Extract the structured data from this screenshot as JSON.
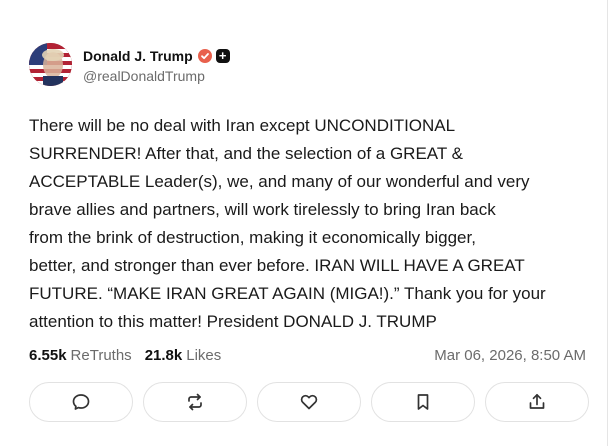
{
  "author": {
    "display_name": "Donald J. Trump",
    "handle": "@realDonaldTrump",
    "verified_icon": "verified-badge-icon",
    "plus_icon": "plus-badge-icon",
    "plus_symbol": "+",
    "accent_color": "#e8604c"
  },
  "post": {
    "text": "There will be no deal with Iran except UNCONDITIONAL\nSURRENDER! After that, and the selection of a GREAT &\nACCEPTABLE Leader(s), we, and many of our wonderful and very\nbrave allies and partners, will work tirelessly to bring Iran back\nfrom the brink of destruction, making it economically bigger,\nbetter, and stronger than ever before. IRAN WILL HAVE A GREAT\nFUTURE. “MAKE IRAN GREAT AGAIN (MIGA!).” Thank you for your\nattention to this matter! President DONALD J. TRUMP"
  },
  "stats": {
    "retruths_count": "6.55k",
    "retruths_label": "ReTruths",
    "likes_count": "21.8k",
    "likes_label": "Likes",
    "timestamp": "Mar 06, 2026, 8:50 AM"
  },
  "actions": [
    {
      "name": "reply",
      "icon": "comment-icon"
    },
    {
      "name": "retruth",
      "icon": "repost-icon"
    },
    {
      "name": "like",
      "icon": "heart-icon"
    },
    {
      "name": "bookmark",
      "icon": "bookmark-icon"
    },
    {
      "name": "share",
      "icon": "share-icon"
    }
  ]
}
